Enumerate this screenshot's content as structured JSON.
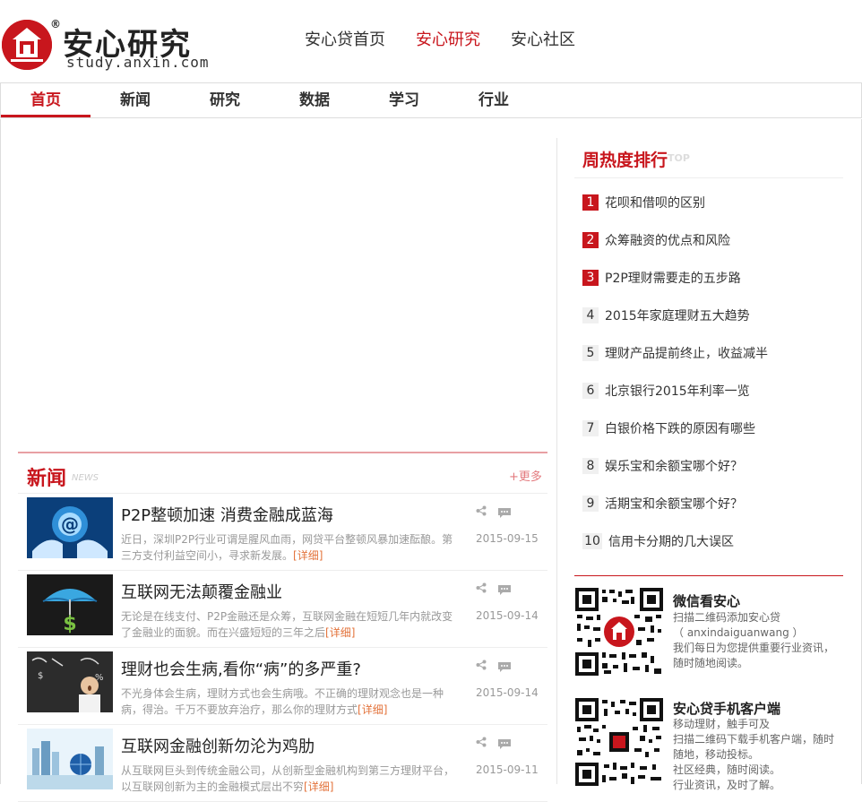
{
  "header": {
    "logo_title": "安心研究",
    "logo_reg": "®",
    "logo_domain": "study.anxin.com",
    "top_nav": [
      {
        "label": "安心贷首页",
        "active": false
      },
      {
        "label": "安心研究",
        "active": true
      },
      {
        "label": "安心社区",
        "active": false
      }
    ]
  },
  "main_nav": [
    {
      "label": "首页",
      "active": true
    },
    {
      "label": "新闻",
      "active": false
    },
    {
      "label": "研究",
      "active": false
    },
    {
      "label": "数据",
      "active": false
    },
    {
      "label": "学习",
      "active": false
    },
    {
      "label": "行业",
      "active": false
    }
  ],
  "news": {
    "title": "新闻",
    "title_en": "NEWS",
    "more": "+更多",
    "items": [
      {
        "headline": "P2P整顿加速 消费金融成蓝海",
        "summary": "近日，深圳P2P行业可谓是腥风血雨，网贷平台整顿风暴加速酝酿。第三方支付利益空间小，寻求新发展。",
        "more": "[详细]",
        "date": "2015-09-15"
      },
      {
        "headline": "互联网无法颠覆金融业",
        "summary": "无论是在线支付、P2P金融还是众筹，互联网金融在短短几年内就改变了金融业的面貌。而在兴盛短短的三年之后",
        "more": "[详细]",
        "date": "2015-09-14"
      },
      {
        "headline": "理财也会生病,看你“病”的多严重?",
        "summary": "不光身体会生病，理财方式也会生病哦。不正确的理财观念也是一种病，得治。千万不要放弃治疗，那么你的理财方式",
        "more": "[详细]",
        "date": "2015-09-14"
      },
      {
        "headline": "互联网金融创新勿沦为鸡肋",
        "summary": "从互联网巨头到传统金融公司，从创新型金融机构到第三方理财平台，以互联网创新为主的金融模式层出不穷",
        "more": "[详细]",
        "date": "2015-09-11"
      }
    ]
  },
  "ranking": {
    "title": "周热度排行",
    "title_en": "TOP",
    "items": [
      {
        "num": "1",
        "text": "花呗和借呗的区别",
        "hot": true
      },
      {
        "num": "2",
        "text": "众筹融资的优点和风险",
        "hot": true
      },
      {
        "num": "3",
        "text": "P2P理财需要走的五步路",
        "hot": true
      },
      {
        "num": "4",
        "text": "2015年家庭理财五大趋势",
        "hot": false
      },
      {
        "num": "5",
        "text": "理财产品提前终止，收益减半",
        "hot": false
      },
      {
        "num": "6",
        "text": "北京银行2015年利率一览",
        "hot": false
      },
      {
        "num": "7",
        "text": "白银价格下跌的原因有哪些",
        "hot": false
      },
      {
        "num": "8",
        "text": "娱乐宝和余额宝哪个好？",
        "hot": false
      },
      {
        "num": "9",
        "text": "活期宝和余额宝哪个好？",
        "hot": false
      },
      {
        "num": "10",
        "text": "信用卡分期的几大误区",
        "hot": false
      }
    ]
  },
  "wechat": {
    "title": "微信看安心",
    "lines": [
      "扫描二维码添加安心贷",
      "（ anxindaiguanwang ）",
      "我们每日为您提供重要行业资讯，随时随地阅读。"
    ]
  },
  "app": {
    "title": "安心贷手机客户端",
    "lines": [
      "移动理财，触手可及",
      "扫描二维码下载手机客户端，随时随地，移动投标。",
      "社区经典，随时阅读。",
      "行业资讯，及时了解。"
    ]
  },
  "colors": {
    "brand": "#c8161d",
    "link_more": "#e3733b"
  }
}
